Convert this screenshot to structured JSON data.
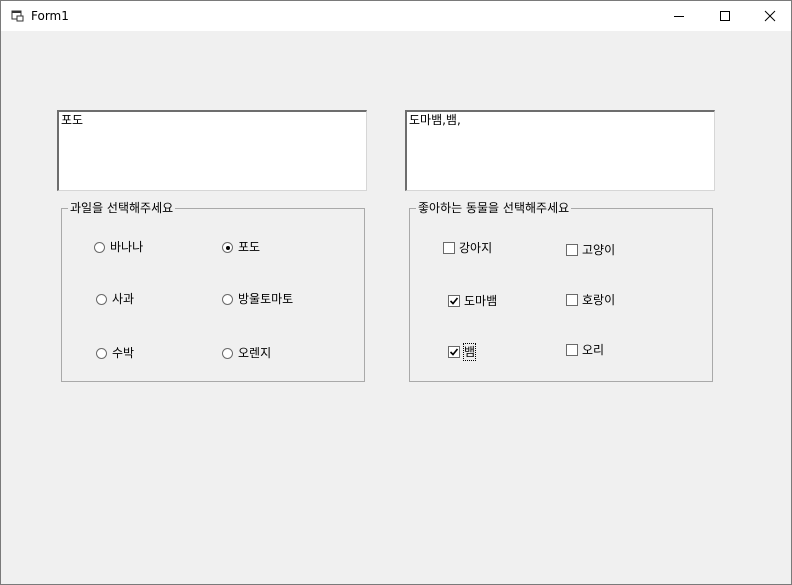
{
  "window": {
    "title": "Form1"
  },
  "fruit": {
    "textbox_value": "포도",
    "group_title": "과일을 선택해주세요",
    "options": [
      {
        "label": "바나나",
        "selected": false
      },
      {
        "label": "포도",
        "selected": true
      },
      {
        "label": "사과",
        "selected": false
      },
      {
        "label": "방울토마토",
        "selected": false
      },
      {
        "label": "수박",
        "selected": false
      },
      {
        "label": "오렌지",
        "selected": false
      }
    ]
  },
  "animal": {
    "textbox_value": "도마뱀,뱀,",
    "group_title": "좋아하는 동물을 선택해주세요",
    "options": [
      {
        "label": "강아지",
        "checked": false
      },
      {
        "label": "고양이",
        "checked": false
      },
      {
        "label": "도마뱀",
        "checked": true
      },
      {
        "label": "호랑이",
        "checked": false
      },
      {
        "label": "뱀",
        "checked": true
      },
      {
        "label": "오리",
        "checked": false
      }
    ]
  }
}
